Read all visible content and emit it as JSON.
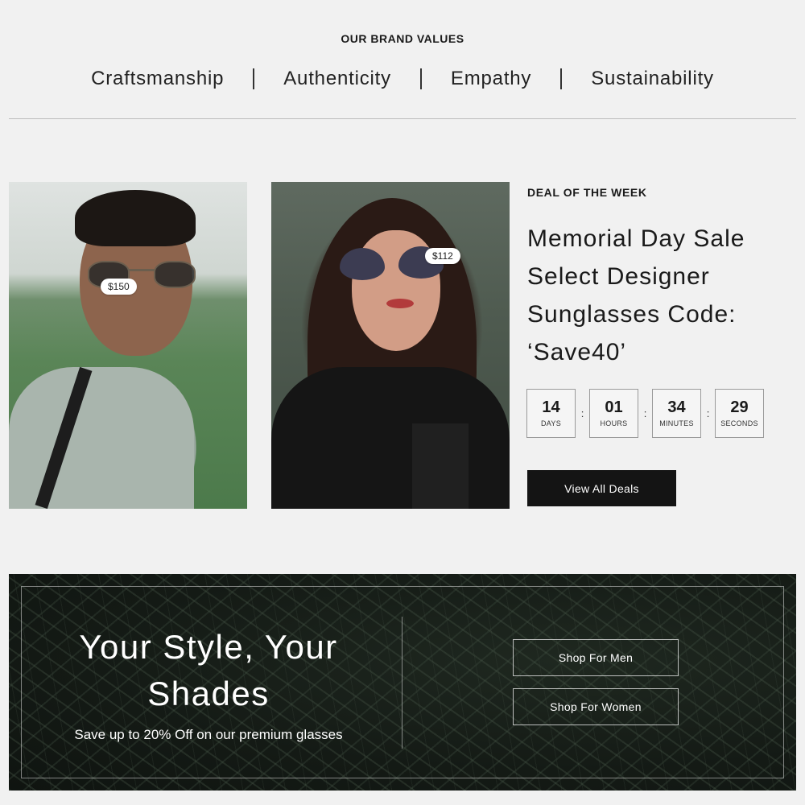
{
  "brand_values": {
    "title": "OUR BRAND VALUES",
    "items": [
      "Craftsmanship",
      "Authenticity",
      "Empathy",
      "Sustainability"
    ]
  },
  "products": [
    {
      "image": "man-wearing-sunglasses",
      "price": "$150"
    },
    {
      "image": "woman-wearing-heart-sunglasses",
      "price": "$112"
    }
  ],
  "deal": {
    "label": "DEAL OF THE WEEK",
    "title": "Memorial Day Sale Select Designer Sunglasses Code: ‘Save40’",
    "countdown": [
      {
        "value": "14",
        "unit": "DAYS"
      },
      {
        "value": "01",
        "unit": "HOURS"
      },
      {
        "value": "34",
        "unit": "MINUTES"
      },
      {
        "value": "29",
        "unit": "SECONDS"
      }
    ],
    "separator": ":",
    "button_label": "View All Deals"
  },
  "banner": {
    "title": "Your Style, Your Shades",
    "subtitle": "Save up to 20% Off on our premium glasses",
    "men_button": "Shop For Men",
    "women_button": "Shop For Women"
  },
  "colors": {
    "background": "#f1f1f1",
    "dark_button": "#141414",
    "banner_bg": "#141a15"
  }
}
